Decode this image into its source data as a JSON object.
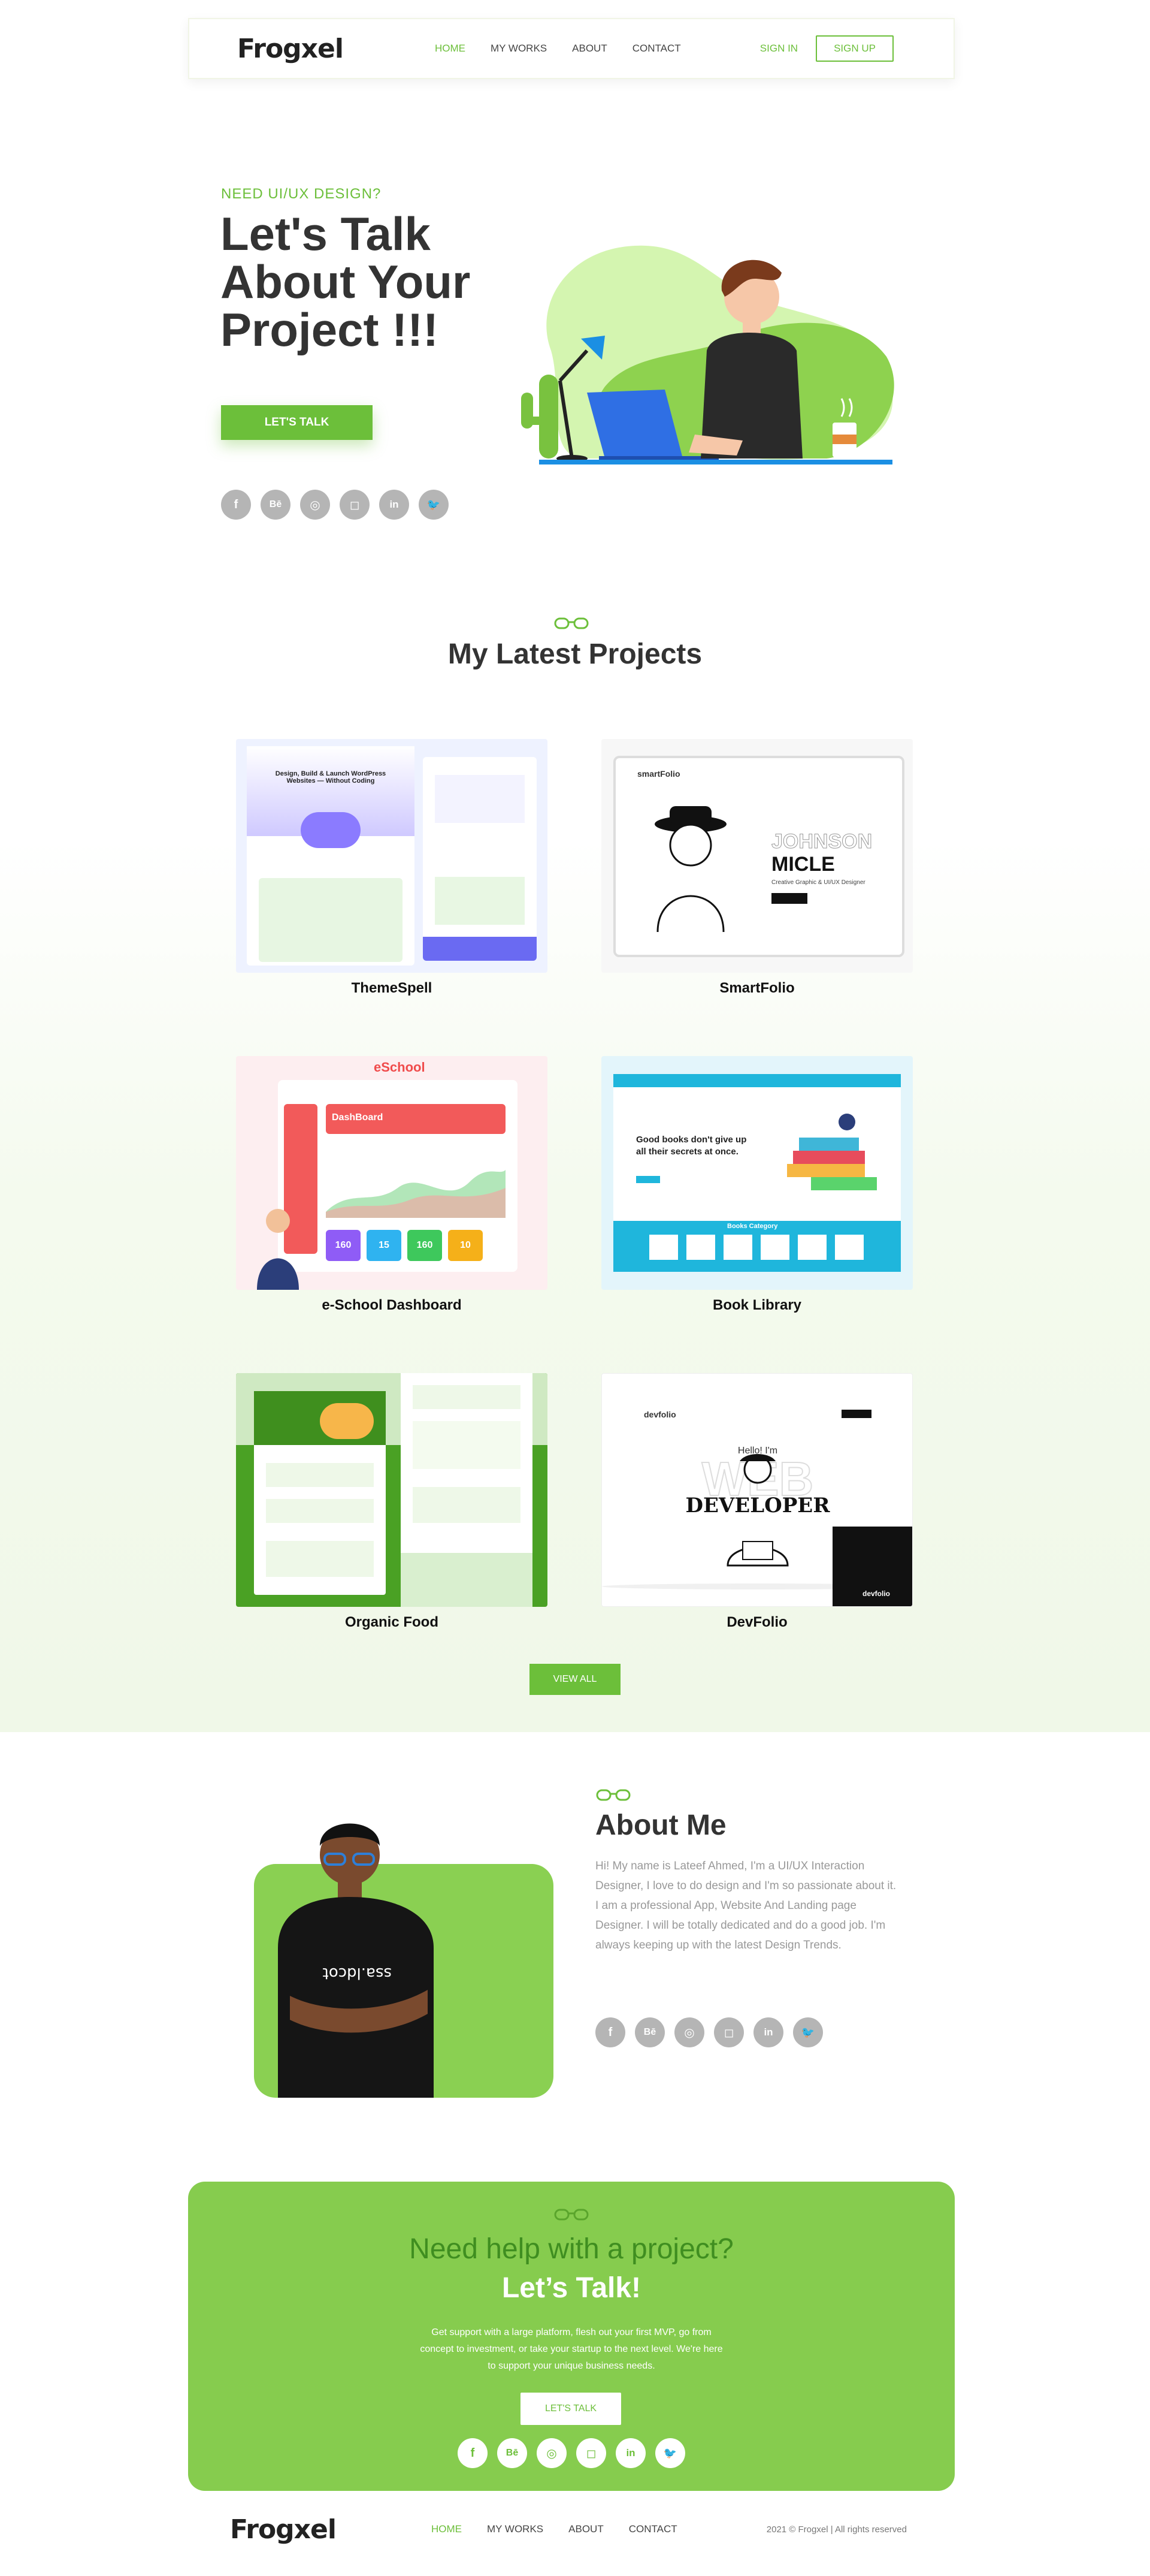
{
  "nav": {
    "logo": "Frogxel",
    "links": [
      "HOME",
      "MY WORKS",
      "ABOUT",
      "CONTACT"
    ],
    "sign_in": "SIGN IN",
    "sign_up": "SIGN UP"
  },
  "hero": {
    "kicker": "NEED UI/UX DESIGN?",
    "title": "Let's Talk About Your Project !!!",
    "button": "LET'S TALK",
    "social": [
      "f",
      "Bē",
      "◎",
      "◻",
      "in",
      "🐦"
    ]
  },
  "projects": {
    "title": "My Latest Projects",
    "items": [
      {
        "name": "ThemeSpell"
      },
      {
        "name": "SmartFolio"
      },
      {
        "name": "e-School Dashboard"
      },
      {
        "name": "Book Library"
      },
      {
        "name": "Organic Food"
      },
      {
        "name": "DevFolio"
      }
    ],
    "view_all": "VIEW ALL",
    "thumb_text": {
      "themespell": "Design, Build & Launch WordPress Websites — Without Coding",
      "smartfolio_brand": "smartFolio",
      "smartfolio_name1": "JOHNSON",
      "smartfolio_name2": "MICLE",
      "smartfolio_sub": "Creative Graphic & UI/UX Designer",
      "eschool_brand": "eSchool",
      "eschool_dash": "DashBoard",
      "eschool_stats": [
        "160",
        "15",
        "160",
        "10"
      ],
      "book_headline": "Good books don't give up all their secrets at once.",
      "book_category": "Books Category",
      "dev_brand": "devfolio",
      "dev_hello": "Hello! I'm",
      "dev_web": "WEB",
      "dev_developer": "DEVELOPER"
    }
  },
  "about": {
    "title": "About Me",
    "text": "Hi! My name is Lateef Ahmed, I'm a UI/UX Interaction Designer, I love to do design and I'm so passionate about it. I am a professional App, Website And Landing page Designer. I will be totally dedicated and do a good job. I'm always keeping up with the latest Design Trends."
  },
  "cta": {
    "heading": "Need help with a project?",
    "subheading": "Let’s Talk!",
    "text": "Get support with a large platform, flesh out your first MVP, go from concept to investment, or take your startup to the next level. We're here to support your unique business needs.",
    "button": "LET'S TALK"
  },
  "footer": {
    "copyright": "2021 © Frogxel | All rights reserved"
  },
  "colors": {
    "accent": "#6cbf3a",
    "accent_light": "#86cc4e",
    "text_dark": "#333333",
    "text_muted": "#999999"
  }
}
